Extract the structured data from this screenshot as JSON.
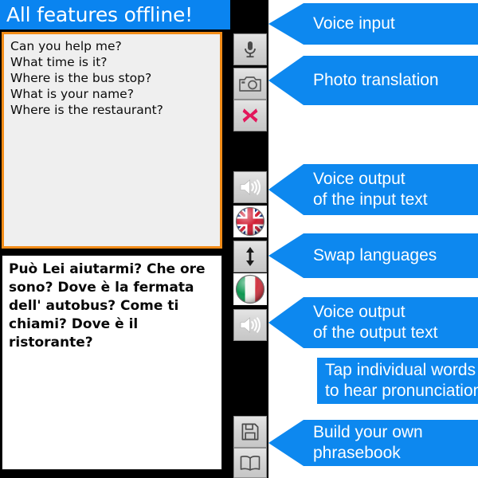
{
  "app": {
    "header_title": "All features offline!",
    "accent_blue": "#0a84f0",
    "callout_blue": "#0d88ef",
    "input_border_orange": "#f28c18",
    "input_background": "#efefef"
  },
  "input_field": {
    "lines": [
      "Can you help me?",
      "What time is it?",
      "Where is the bus stop?",
      "What is your name?",
      "Where is the restaurant?"
    ]
  },
  "output_field": {
    "text": "Può Lei aiutarmi? Che ore sono? Dove è la fermata dell' autobus? Come ti chiami? Dove è il ristorante?"
  },
  "toolbar": {
    "buttons": [
      {
        "name": "microphone-button",
        "icon": "microphone-icon"
      },
      {
        "name": "camera-button",
        "icon": "camera-icon"
      },
      {
        "name": "clear-button",
        "icon": "red-x-icon"
      },
      {
        "name": "speak-input-button",
        "icon": "speaker-icon"
      },
      {
        "name": "source-language-button",
        "icon": "uk-flag-icon"
      },
      {
        "name": "swap-languages-button",
        "icon": "swap-arrows-icon"
      },
      {
        "name": "target-language-button",
        "icon": "italy-flag-icon"
      },
      {
        "name": "speak-output-button",
        "icon": "speaker-icon"
      },
      {
        "name": "save-phrase-button",
        "icon": "floppy-disk-icon"
      },
      {
        "name": "phrasebook-button",
        "icon": "book-icon"
      }
    ]
  },
  "callouts": [
    {
      "id": "voice-input",
      "lines": [
        "Voice input"
      ]
    },
    {
      "id": "photo-translation",
      "lines": [
        "Photo translation"
      ]
    },
    {
      "id": "voice-output-input",
      "lines": [
        "Voice output",
        "of the input text"
      ]
    },
    {
      "id": "swap-languages",
      "lines": [
        "Swap languages"
      ]
    },
    {
      "id": "voice-output-output",
      "lines": [
        "Voice output",
        "of the output text"
      ]
    },
    {
      "id": "tap-words",
      "lines": [
        "Tap individual words",
        "to hear pronunciation"
      ]
    },
    {
      "id": "phrasebook",
      "lines": [
        "Build your own",
        "phrasebook"
      ]
    }
  ]
}
